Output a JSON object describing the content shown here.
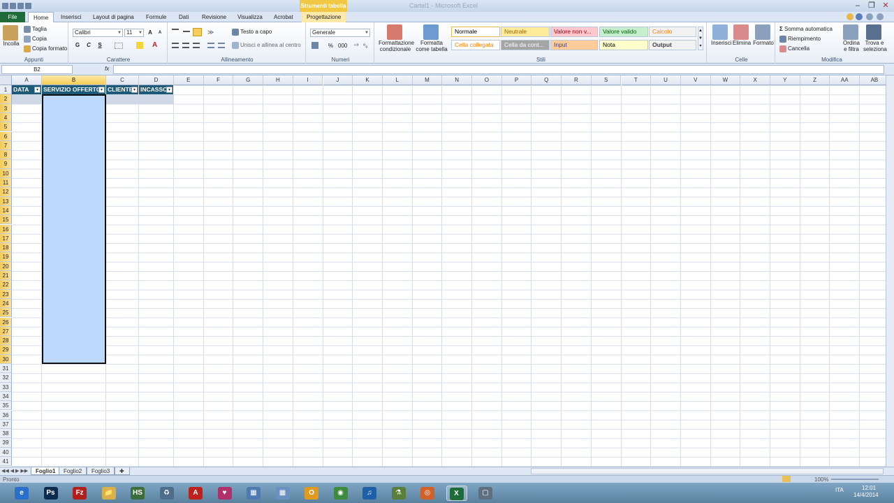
{
  "window": {
    "context_tab": "Strumenti tabella",
    "title": "Cartel1 - Microsoft Excel",
    "buttons": [
      "–",
      "❐",
      "✕"
    ]
  },
  "tabs": [
    "File",
    "Home",
    "Inserisci",
    "Layout di pagina",
    "Formule",
    "Dati",
    "Revisione",
    "Visualizza",
    "Acrobat",
    "Progettazione"
  ],
  "ribbon": {
    "appunti": {
      "label": "Appunti",
      "paste": "Incolla",
      "cut": "Taglia",
      "copy": "Copia",
      "format_painter": "Copia formato"
    },
    "carattere": {
      "label": "Carattere",
      "font": "Calibri",
      "size": "11",
      "bold": "G",
      "italic": "C",
      "underline": "S"
    },
    "allineamento": {
      "label": "Allineamento",
      "wrap": "Testo a capo",
      "merge": "Unisci e allinea al centro"
    },
    "numeri": {
      "label": "Numeri",
      "format": "Generale",
      "percent": "%",
      "thousands": "000"
    },
    "stili": {
      "label": "Stili",
      "cond_format": "Formattazione condizionale",
      "format_table": "Formatta come tabella",
      "cells": [
        "Normale",
        "Neutrale",
        "Valore non v...",
        "Valore valido",
        "Calcolo",
        "Cella collegata",
        "Cella da cont...",
        "Input",
        "Nota",
        "Output"
      ]
    },
    "celle": {
      "label": "Celle",
      "insert": "Inserisci",
      "delete": "Elimina",
      "format": "Formato"
    },
    "modifica": {
      "label": "Modifica",
      "autosum": "Somma automatica",
      "fill": "Riempimento",
      "clear": "Cancella",
      "sort": "Ordina e filtra",
      "find": "Trova e seleziona"
    }
  },
  "formula_bar": {
    "name_box": "B2",
    "fx": "fx",
    "value": ""
  },
  "columns": [
    "A",
    "B",
    "C",
    "D",
    "E",
    "F",
    "G",
    "H",
    "I",
    "J",
    "K",
    "L",
    "M",
    "N",
    "O",
    "P",
    "Q",
    "R",
    "S",
    "T",
    "U",
    "V",
    "W",
    "X",
    "Y",
    "Z",
    "AA",
    "AB"
  ],
  "rows": [
    "1",
    "2",
    "3",
    "4",
    "5",
    "6",
    "7",
    "8",
    "9",
    "10",
    "11",
    "12",
    "13",
    "14",
    "15",
    "16",
    "17",
    "18",
    "19",
    "20",
    "21",
    "22",
    "23",
    "24",
    "25",
    "26",
    "27",
    "28",
    "29",
    "30",
    "31",
    "32",
    "33",
    "34",
    "35",
    "36",
    "37",
    "38",
    "39",
    "40",
    "41"
  ],
  "table_headers": [
    "DATA",
    "SERVIZIO OFFERTO",
    "CLIENTE",
    "INCASSO"
  ],
  "sheets": [
    "Foglio1",
    "Foglio2",
    "Foglio3"
  ],
  "status": {
    "mode": "Pronto",
    "zoom": "100%"
  },
  "taskbar": {
    "apps": [
      "e",
      "Ps",
      "Fz",
      "📁",
      "HS",
      "♻",
      "A",
      "♥",
      "▦",
      "▦",
      "O",
      "◉",
      "♫",
      "⚗",
      "◎",
      "X",
      "▢"
    ],
    "time": "12:01",
    "date": "14/4/2014",
    "lang": "ITA"
  }
}
